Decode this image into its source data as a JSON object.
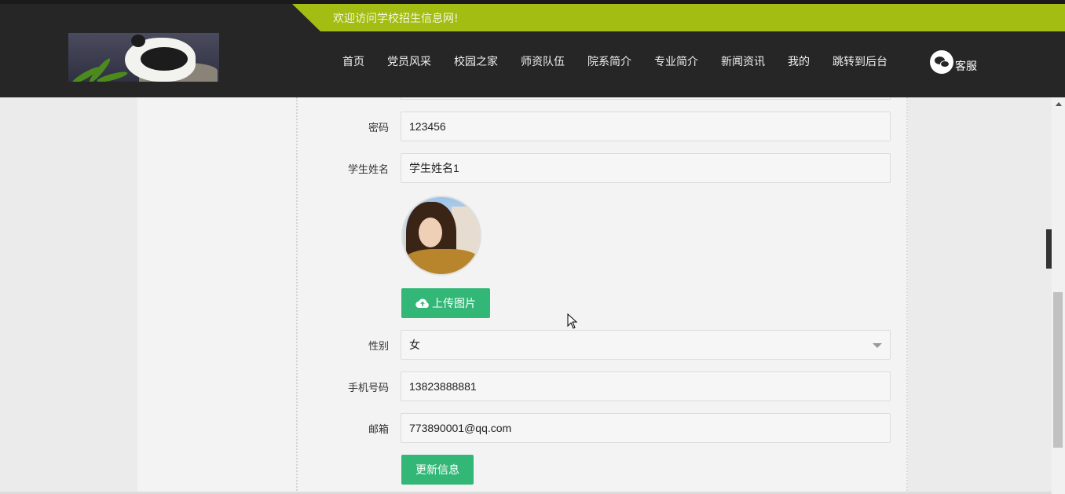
{
  "header": {
    "welcome": "欢迎访问学校招生信息网!",
    "nav": [
      "首页",
      "党员风采",
      "校园之家",
      "师资队伍",
      "院系简介",
      "专业简介",
      "新闻资讯",
      "我的",
      "跳转到后台"
    ],
    "service_label": "客服",
    "accent_color": "#a3bd12"
  },
  "form": {
    "password_label": "密码",
    "password_value": "123456",
    "name_label": "学生姓名",
    "name_value": "学生姓名1",
    "upload_label": "上传图片",
    "gender_label": "性别",
    "gender_value": "女",
    "phone_label": "手机号码",
    "phone_value": "13823888881",
    "email_label": "邮箱",
    "email_value": "773890001@qq.com",
    "submit_label": "更新信息",
    "button_color": "#33b777"
  },
  "drawer": {
    "toggle_glyph": "‹"
  }
}
